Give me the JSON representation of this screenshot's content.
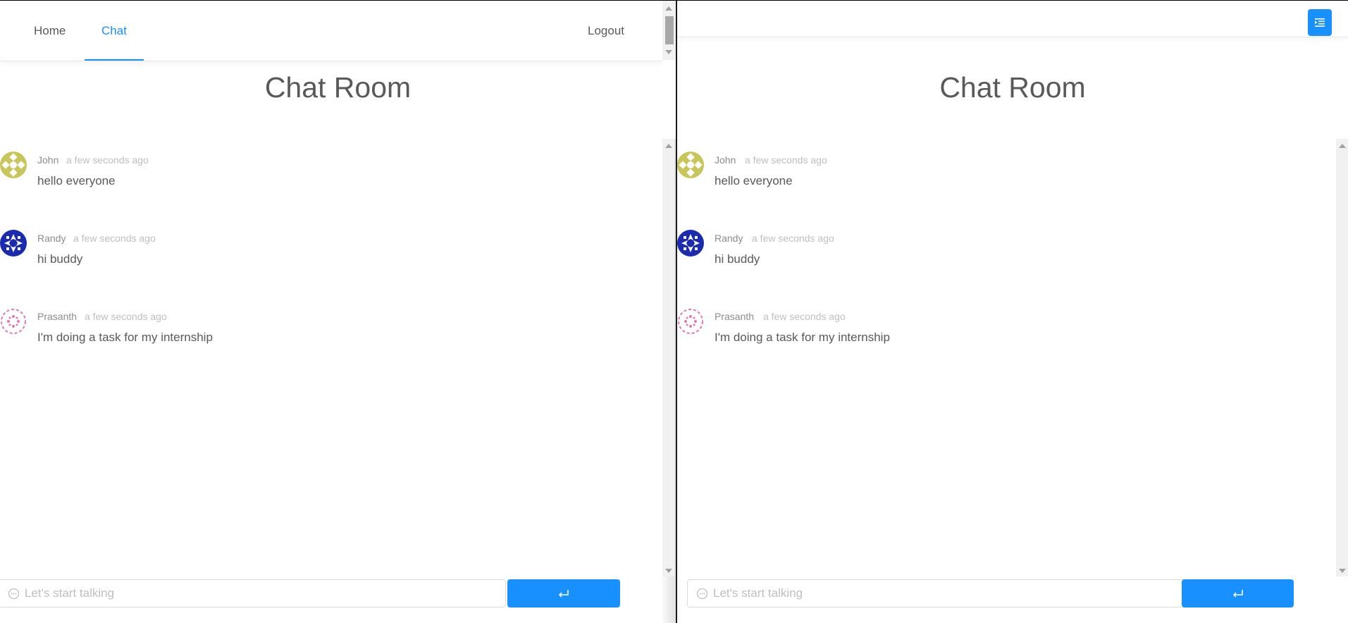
{
  "nav": {
    "home": "Home",
    "chat": "Chat",
    "logout": "Logout"
  },
  "room_title": "Chat Room",
  "messages": [
    {
      "author": "John",
      "time": "a few seconds ago",
      "text": "hello everyone",
      "avatar_color": "#c8c55a"
    },
    {
      "author": "Randy",
      "time": "a few seconds ago",
      "text": "hi buddy",
      "avatar_color": "#1a2bb0"
    },
    {
      "author": "Prasanth",
      "time": "a few seconds ago",
      "text": "I'm doing a task for my internship",
      "avatar_color": "#e07ab0"
    }
  ],
  "input": {
    "placeholder": "Let's start talking"
  },
  "colors": {
    "accent": "#1890ff"
  },
  "icons": {
    "send": "enter-icon",
    "menu": "menu-fold-icon",
    "input": "message-icon"
  }
}
